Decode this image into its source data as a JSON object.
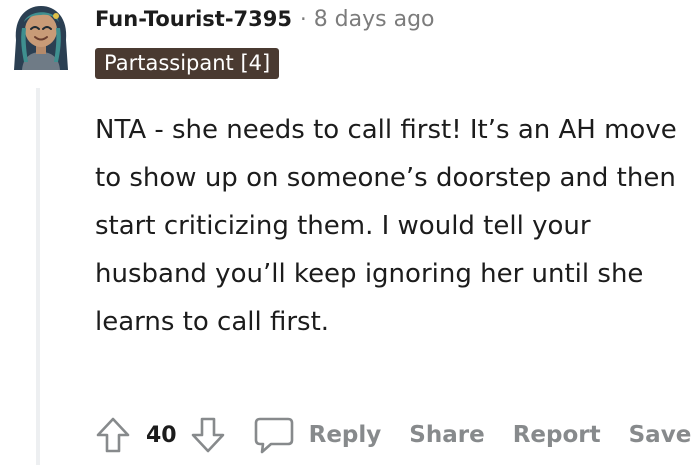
{
  "comment": {
    "author": "Fun-Tourist-7395",
    "separator": "·",
    "timestamp": "8 days ago",
    "flair": "Partassipant [4]",
    "body": "NTA - she needs to call first! It’s an AH move to show up on someone’s doorstep and then start criticizing them. I would tell your husband you’ll keep ignoring her until she learns to call first."
  },
  "actions": {
    "score": "40",
    "reply": "Reply",
    "share": "Share",
    "report": "Report",
    "save": "Save"
  },
  "icons": {
    "avatar": "avatar",
    "upvote": "upvote-arrow-icon",
    "downvote": "downvote-arrow-icon",
    "reply": "speech-bubble-icon"
  },
  "colors": {
    "text": "#1c1c1c",
    "muted": "#7c7c7c",
    "action": "#878a8c",
    "flair_bg": "#4a3a31",
    "thread_line": "#edeff1"
  }
}
